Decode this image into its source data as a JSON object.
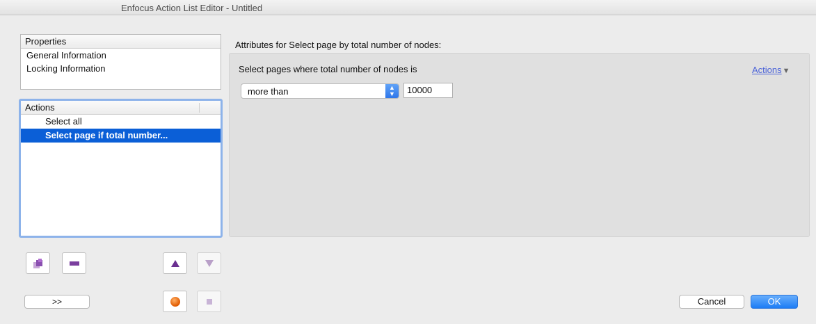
{
  "window": {
    "title": "Enfocus Action List Editor - Untitled"
  },
  "properties": {
    "header": "Properties",
    "items": [
      {
        "label": "General Information"
      },
      {
        "label": "Locking Information"
      }
    ]
  },
  "actions": {
    "header": "Actions",
    "items": [
      {
        "label": "Select all",
        "selected": false
      },
      {
        "label": "Select page if total number...",
        "selected": true
      }
    ]
  },
  "buttons": {
    "expand_label": ">>",
    "cancel_label": "Cancel",
    "ok_label": "OK"
  },
  "attributes": {
    "title": "Attributes for Select page by total number of nodes:",
    "criteria_label": "Select pages where total number of nodes is",
    "actions_menu": "Actions",
    "comparison": {
      "value": "more than"
    },
    "node_count": "10000"
  },
  "icons": {
    "add": "add-action-icon",
    "remove": "minus-icon",
    "move_up": "triangle-up-icon",
    "move_down": "triangle-down-icon",
    "record": "record-icon",
    "stop": "stop-icon"
  },
  "colors": {
    "selection": "#0b5fd7",
    "ok_button": "#1c7cf5",
    "link": "#4b63d8",
    "accent_purple": "#7b3f9e"
  }
}
